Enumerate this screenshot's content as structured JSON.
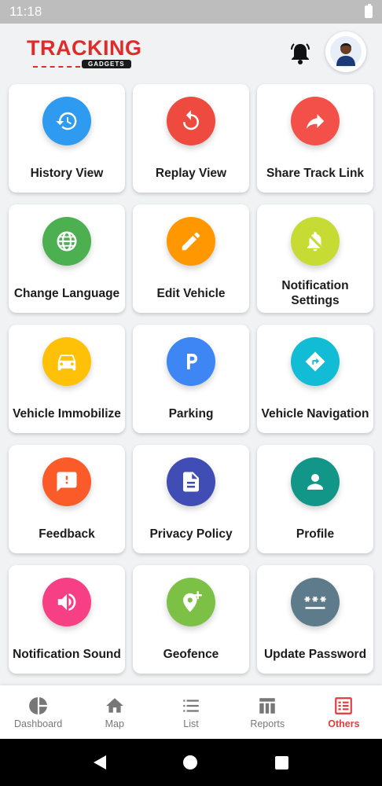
{
  "status_bar": {
    "time": "11:18"
  },
  "header": {
    "logo_main": "TRACKING",
    "logo_sub": "GADGETS",
    "bell_icon": "bell-icon",
    "avatar_icon": "user-avatar"
  },
  "menu": [
    {
      "label": "History View",
      "color": "#2e9bf0",
      "icon": "history-icon"
    },
    {
      "label": "Replay View",
      "color": "#ef4a3f",
      "icon": "replay-icon"
    },
    {
      "label": "Share Track Link",
      "color": "#f4504a",
      "icon": "share-icon"
    },
    {
      "label": "Change Language",
      "color": "#4caf50",
      "icon": "globe-icon"
    },
    {
      "label": "Edit Vehicle",
      "color": "#ff9800",
      "icon": "pencil-icon"
    },
    {
      "label": "Notification Settings",
      "color": "#c6dc34",
      "icon": "bell-settings-icon"
    },
    {
      "label": "Vehicle Immobilize",
      "color": "#ffc107",
      "icon": "car-icon"
    },
    {
      "label": "Parking",
      "color": "#3d86f4",
      "icon": "parking-icon"
    },
    {
      "label": "Vehicle Navigation",
      "color": "#12bcd4",
      "icon": "navigation-icon"
    },
    {
      "label": "Feedback",
      "color": "#fa5b28",
      "icon": "feedback-icon"
    },
    {
      "label": "Privacy Policy",
      "color": "#3f4db5",
      "icon": "document-icon"
    },
    {
      "label": "Profile",
      "color": "#119688",
      "icon": "person-icon"
    },
    {
      "label": "Notification Sound",
      "color": "#f73f85",
      "icon": "volume-icon"
    },
    {
      "label": "Geofence",
      "color": "#7cc146",
      "icon": "geofence-icon"
    },
    {
      "label": "Update Password",
      "color": "#5d7b8a",
      "icon": "password-icon"
    }
  ],
  "bottom_nav": [
    {
      "label": "Dashboard",
      "icon": "pie-chart-icon",
      "active": false
    },
    {
      "label": "Map",
      "icon": "home-icon",
      "active": false
    },
    {
      "label": "List",
      "icon": "list-icon",
      "active": false
    },
    {
      "label": "Reports",
      "icon": "reports-icon",
      "active": false
    },
    {
      "label": "Others",
      "icon": "others-icon",
      "active": true
    }
  ],
  "colors": {
    "accent": "#e23b3b",
    "background": "#f1f2f4"
  }
}
